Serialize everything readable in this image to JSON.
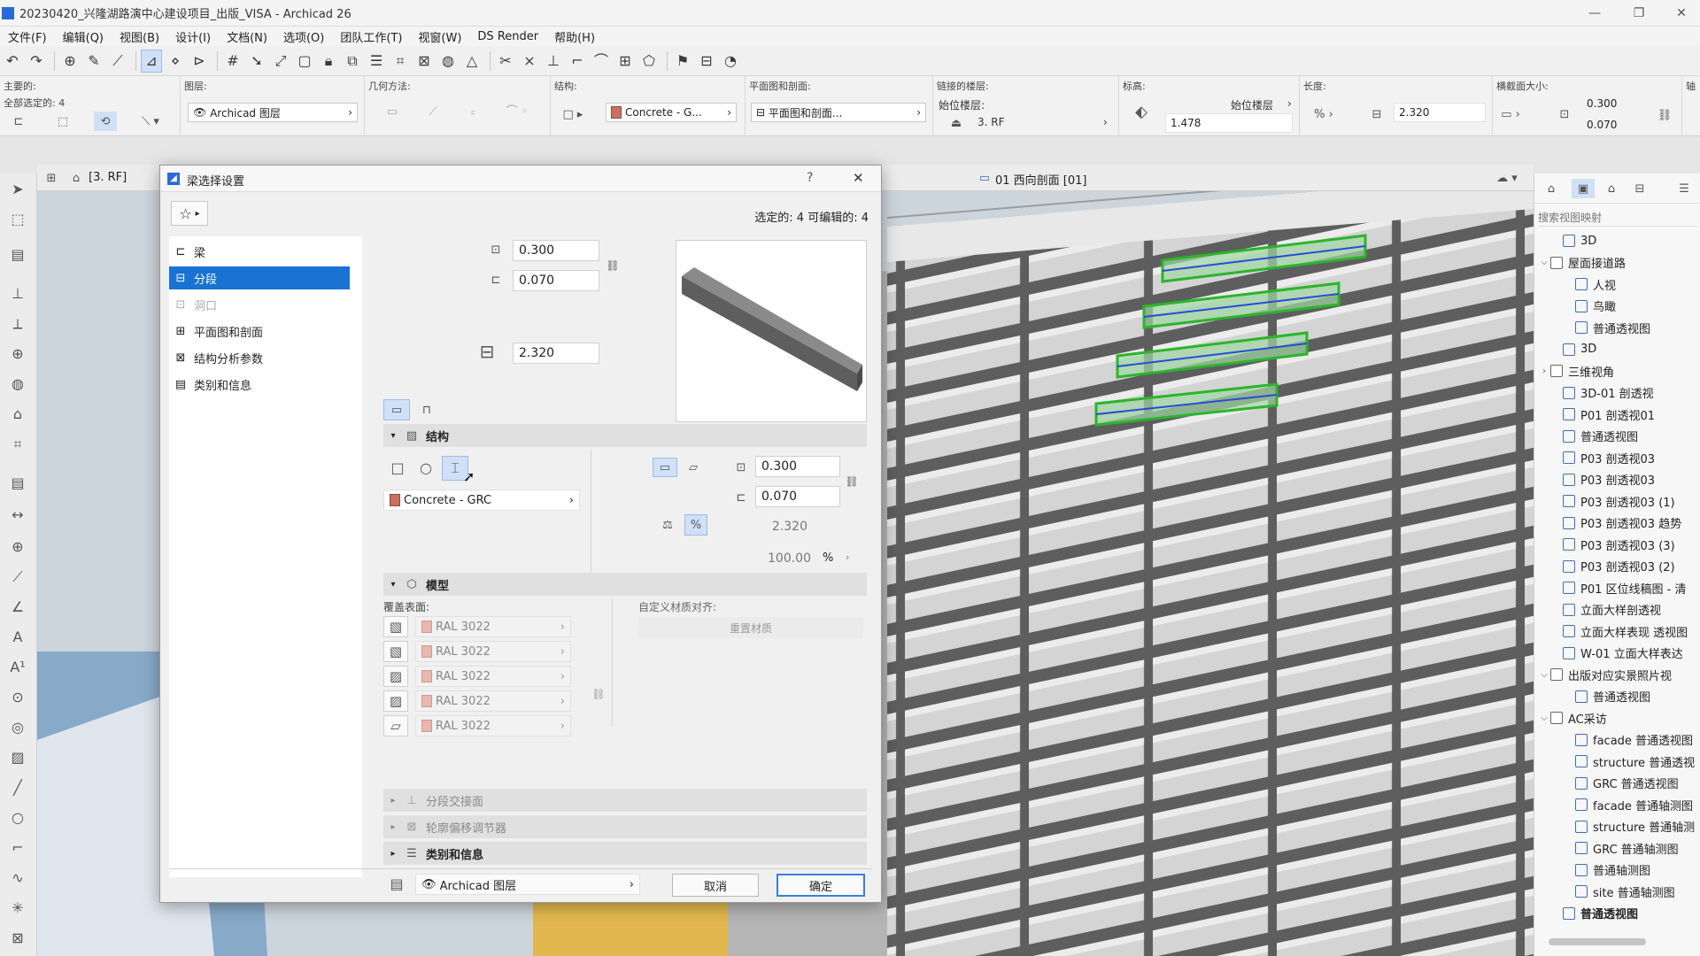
{
  "window": {
    "title": "20230420_兴隆湖路演中心建设项目_出版_VISA - Archicad 26",
    "min": "—",
    "max": "❐",
    "close": "✕"
  },
  "menu": [
    "文件(F)",
    "编辑(Q)",
    "视图(B)",
    "设计(I)",
    "文档(N)",
    "选项(O)",
    "团队工作(T)",
    "视窗(W)",
    "DS Render",
    "帮助(H)"
  ],
  "infobox": {
    "main_label": "主要的:",
    "selected_label": "全部选定的: 4",
    "layer_label": "图层:",
    "layer_value": "Archicad 图层",
    "geometry_label": "几何方法:",
    "structure_label": "结构:",
    "structure_value": "Concrete - G...",
    "plan_section_label": "平面图和剖面:",
    "plan_section_value": "平面图和剖面...",
    "linked_story_label": "链接的楼层:",
    "home_story_label": "始位楼层:",
    "home_story_value": "3. RF",
    "elevation_label": "标高:",
    "home_story_select": "始位楼层",
    "elevation_value": "1.478",
    "length_label": "长度:",
    "length_value": "2.320",
    "cross_section_label": "横截面大小:",
    "width_value": "0.300",
    "height_value": "0.070",
    "extra_label": "轴"
  },
  "view_tabs": {
    "plan_tab": "[3. RF]",
    "section_tab": "01 西向剖面 [01]"
  },
  "dialog": {
    "title": "梁选择设置",
    "help": "?",
    "close": "✕",
    "favorites": "☆",
    "selection_status": "选定的: 4 可编辑的: 4",
    "tree": [
      {
        "label": "梁",
        "state": "normal"
      },
      {
        "label": "分段",
        "state": "selected"
      },
      {
        "label": "洞口",
        "state": "disabled"
      },
      {
        "label": "平面图和剖面",
        "state": "normal"
      },
      {
        "label": "结构分析参数",
        "state": "normal"
      },
      {
        "label": "类别和信息",
        "state": "normal"
      }
    ],
    "top_width": "0.300",
    "top_height": "0.070",
    "top_length": "2.320",
    "structure": {
      "header": "结构",
      "material": "Concrete - GRC",
      "width": "0.300",
      "height": "0.070",
      "length": "2.320",
      "percent_value": "100.00",
      "percent_unit": "%"
    },
    "model": {
      "header": "模型",
      "override_label": "覆盖表面:",
      "surfaces": [
        "RAL 3022",
        "RAL 3022",
        "RAL 3022",
        "RAL 3022",
        "RAL 3022"
      ],
      "custom_align_label": "自定义材质对齐:",
      "reset_texture": "重置材质"
    },
    "collapsed_sections": [
      "分段交接面",
      "轮廓偏移调节器",
      "类别和信息"
    ],
    "footer_layer": "Archicad 图层",
    "cancel": "取消",
    "ok": "确定"
  },
  "navigator": {
    "search_placeholder": "搜索视图映射",
    "items": [
      {
        "label": "3D",
        "indent": 1,
        "folder": false,
        "arrow": ""
      },
      {
        "label": "屋面接道路",
        "indent": 0,
        "folder": true,
        "arrow": "⌵"
      },
      {
        "label": "人视",
        "indent": 2,
        "folder": false,
        "arrow": ""
      },
      {
        "label": "鸟瞰",
        "indent": 2,
        "folder": false,
        "arrow": ""
      },
      {
        "label": "普通透视图",
        "indent": 2,
        "folder": false,
        "arrow": ""
      },
      {
        "label": "3D",
        "indent": 1,
        "folder": false,
        "arrow": ""
      },
      {
        "label": "三维视角",
        "indent": 0,
        "folder": true,
        "arrow": "›"
      },
      {
        "label": "3D-01 剖透视",
        "indent": 1,
        "folder": false,
        "arrow": ""
      },
      {
        "label": "P01 剖透视01",
        "indent": 1,
        "folder": false,
        "arrow": ""
      },
      {
        "label": "普通透视图",
        "indent": 1,
        "folder": false,
        "arrow": ""
      },
      {
        "label": "P03 剖透视03",
        "indent": 1,
        "folder": false,
        "arrow": ""
      },
      {
        "label": "P03 剖透视03",
        "indent": 1,
        "folder": false,
        "arrow": ""
      },
      {
        "label": "P03 剖透视03 (1)",
        "indent": 1,
        "folder": false,
        "arrow": ""
      },
      {
        "label": "P03 剖透视03 趋势",
        "indent": 1,
        "folder": false,
        "arrow": ""
      },
      {
        "label": "P03 剖透视03 (3)",
        "indent": 1,
        "folder": false,
        "arrow": ""
      },
      {
        "label": "P03 剖透视03 (2)",
        "indent": 1,
        "folder": false,
        "arrow": ""
      },
      {
        "label": "P01 区位线稿图 - 清",
        "indent": 1,
        "folder": false,
        "arrow": ""
      },
      {
        "label": "立面大样剖透视",
        "indent": 1,
        "folder": false,
        "arrow": ""
      },
      {
        "label": "立面大样表现 透视图",
        "indent": 1,
        "folder": false,
        "arrow": ""
      },
      {
        "label": "W-01 立面大样表达",
        "indent": 1,
        "folder": false,
        "arrow": ""
      },
      {
        "label": "出版对应实景照片视",
        "indent": 0,
        "folder": true,
        "arrow": "⌵"
      },
      {
        "label": "普通透视图",
        "indent": 2,
        "folder": false,
        "arrow": ""
      },
      {
        "label": "AC采访",
        "indent": 0,
        "folder": true,
        "arrow": "⌵"
      },
      {
        "label": "facade 普通透视图",
        "indent": 2,
        "folder": false,
        "arrow": ""
      },
      {
        "label": "structure 普通透视",
        "indent": 2,
        "folder": false,
        "arrow": ""
      },
      {
        "label": "GRC 普通透视图",
        "indent": 2,
        "folder": false,
        "arrow": ""
      },
      {
        "label": "facade 普通轴测图",
        "indent": 2,
        "folder": false,
        "arrow": ""
      },
      {
        "label": "structure 普通轴测",
        "indent": 2,
        "folder": false,
        "arrow": ""
      },
      {
        "label": "GRC 普通轴测图",
        "indent": 2,
        "folder": false,
        "arrow": ""
      },
      {
        "label": "普通轴测图",
        "indent": 2,
        "folder": false,
        "arrow": ""
      },
      {
        "label": "site 普通轴测图",
        "indent": 2,
        "folder": false,
        "arrow": ""
      },
      {
        "label": "普通透视图",
        "indent": 1,
        "folder": false,
        "arrow": "",
        "bold": true
      }
    ]
  },
  "colors": {
    "selection_blue": "#1873d3",
    "highlight_green": "#2bb52b",
    "material_swatch": "#c9705e"
  }
}
